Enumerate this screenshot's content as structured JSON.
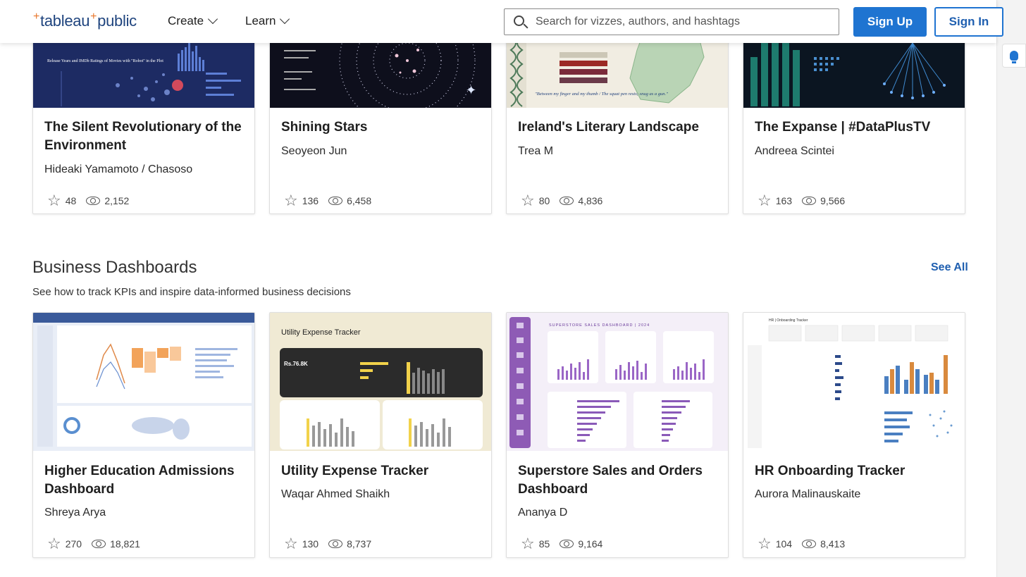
{
  "header": {
    "logo_left": "tableau",
    "logo_right": "public",
    "nav": [
      {
        "label": "Create"
      },
      {
        "label": "Learn"
      }
    ],
    "search_placeholder": "Search for vizzes, authors, and hashtags",
    "signup_label": "Sign Up",
    "signin_label": "Sign In"
  },
  "top_row": [
    {
      "title": "The Silent Revolutionary of the Environment",
      "author": "Hideaki Yamamoto / Chasoso",
      "stars": "48",
      "views": "2,152"
    },
    {
      "title": "Shining Stars",
      "author": "Seoyeon Jun",
      "stars": "136",
      "views": "6,458"
    },
    {
      "title": "Ireland's Literary Landscape",
      "author": "Trea M",
      "stars": "80",
      "views": "4,836"
    },
    {
      "title": "The Expanse | #DataPlusTV",
      "author": "Andreea Scintei",
      "stars": "163",
      "views": "9,566"
    }
  ],
  "section": {
    "title": "Business Dashboards",
    "description": "See how to track KPIs and inspire data-informed business decisions",
    "see_all": "See All"
  },
  "bottom_row": [
    {
      "title": "Higher Education Admissions Dashboard",
      "author": "Shreya Arya",
      "stars": "270",
      "views": "18,821"
    },
    {
      "title": "Utility Expense Tracker",
      "author": "Waqar Ahmed Shaikh",
      "stars": "130",
      "views": "8,737"
    },
    {
      "title": "Superstore Sales and Orders Dashboard",
      "author": "Ananya D",
      "stars": "85",
      "views": "9,164"
    },
    {
      "title": "HR Onboarding Tracker",
      "author": "Aurora Malinauskaite",
      "stars": "104",
      "views": "8,413"
    }
  ],
  "thumb_text": {
    "robot_title": "Release Years and IMDb Ratings of Movies with \"Robot\" in the Plot",
    "utility_title": "Utility Expense Tracker",
    "utility_total": "Rs.76.8K",
    "superstore_title": "SUPERSTORE SALES DASHBOARD | 2024",
    "hr_title": "HR | Onboarding Tracker",
    "ireland_quote": "\"Between my finger and my thumb / The squat pen rests; snug as a gun.\""
  }
}
